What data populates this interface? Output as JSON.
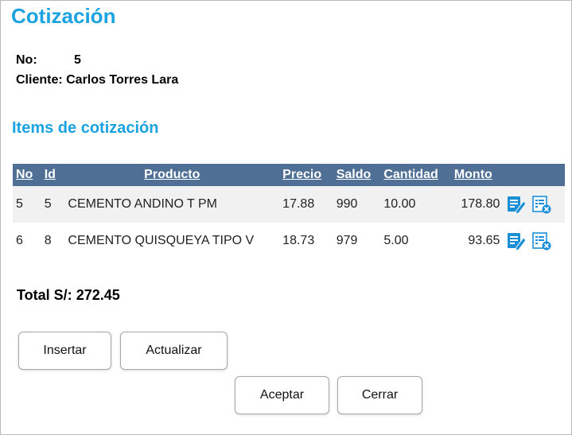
{
  "title": "Cotización",
  "quote": {
    "no_label": "No:",
    "no_value": "5",
    "client_label": "Cliente:",
    "client_value": "Carlos Torres Lara"
  },
  "items_title": "Items de cotización",
  "table": {
    "headers": [
      "No",
      "Id",
      "Producto",
      "Precio",
      "Saldo",
      "Cantidad",
      "Monto"
    ],
    "rows": [
      {
        "no": "5",
        "id": "5",
        "producto": "CEMENTO ANDINO T PM",
        "precio": "17.88",
        "saldo": "990",
        "cantidad": "10.00",
        "monto": "178.80"
      },
      {
        "no": "6",
        "id": "8",
        "producto": "CEMENTO QUISQUEYA TIPO V",
        "precio": "18.73",
        "saldo": "979",
        "cantidad": "5.00",
        "monto": "93.65"
      }
    ],
    "row_icons": [
      "edit-icon",
      "delete-icon"
    ]
  },
  "total": {
    "label": "Total S/:",
    "value": "272.45"
  },
  "buttons": {
    "insertar": "Insertar",
    "actualizar": "Actualizar",
    "aceptar": "Aceptar",
    "cerrar": "Cerrar"
  },
  "colors": {
    "accent": "#1aa3e0",
    "header_bg": "#4f6f94",
    "row_alt_bg": "#f1f1f1"
  }
}
